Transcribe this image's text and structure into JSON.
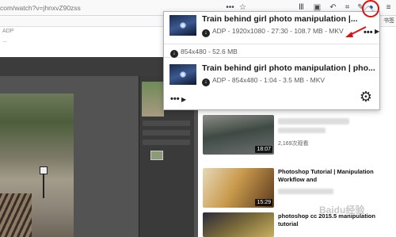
{
  "browser": {
    "url": "com/watch?v=jhnxvZ90zss",
    "toolbar_icons": [
      "more-dots-icon",
      "bookmark-star-icon",
      "library-icon",
      "sidebar-icon",
      "back-arrow-icon",
      "crop-icon",
      "comment-icon",
      "extension-icon",
      "menu-icon"
    ],
    "more_label": "•••",
    "star_label": "☆",
    "bookmarks_label": "书签"
  },
  "left_strip": {
    "line1": "ADP",
    "line2": "..."
  },
  "popup": {
    "videos": [
      {
        "title": "Train behind girl photo manipulation |...",
        "meta": "ADP - 1920x1080 - 27:30 - 108.7 MB - MKV",
        "more": "•••"
      },
      {
        "title": "Train behind girl photo manipulation | pho...",
        "meta": "ADP - 854x480 - 1:04 - 3.5 MB - MKV"
      }
    ],
    "variant": "854x480 - 52.6 MB",
    "footer_more": "•••",
    "play_icon": "▶",
    "gear_icon": "⚙"
  },
  "feed": [
    {
      "duration": "18:07",
      "views": "2,169次观看"
    },
    {
      "title": "Photoshop Tutorial | Manipulation Workflow and",
      "duration": "15:29"
    },
    {
      "title": "photoshop cc 2015.5 manipulation tutorial"
    }
  ],
  "watermark": "Baidu经验",
  "colors": {
    "accent_red": "#e01010",
    "photoshop_bg": "#535353"
  }
}
